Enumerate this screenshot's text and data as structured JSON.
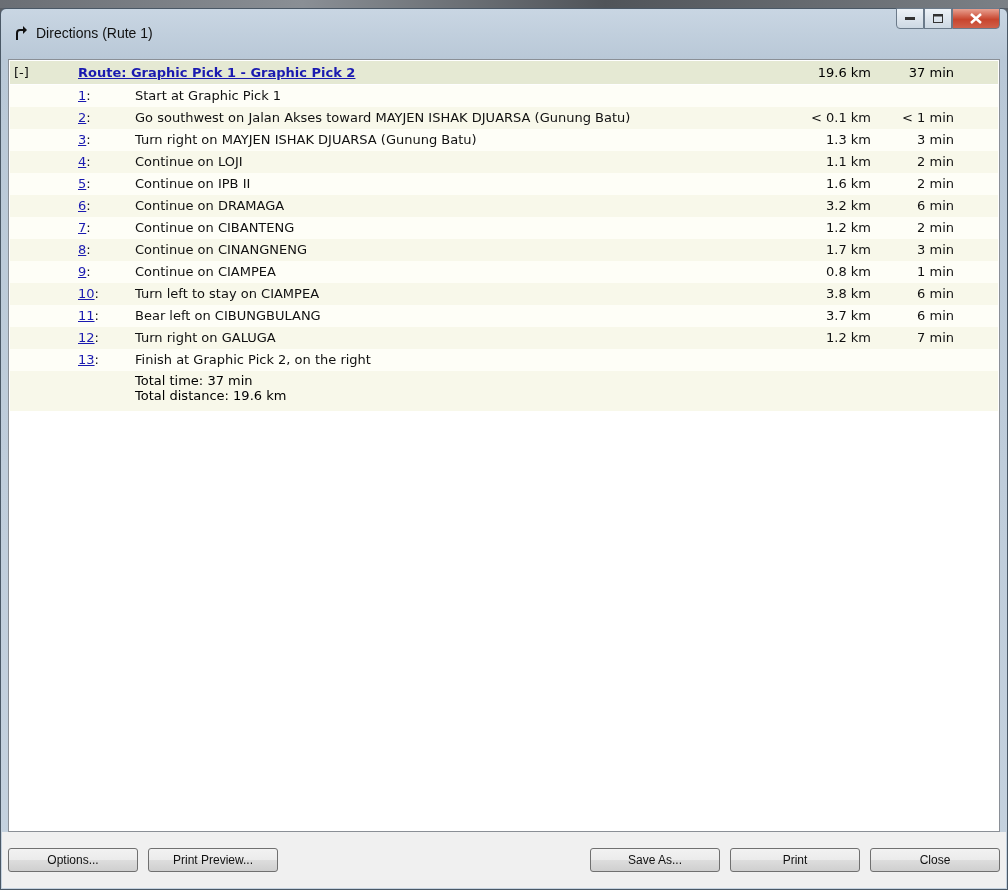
{
  "window": {
    "title": "Directions (Rute 1)"
  },
  "route": {
    "toggle": "[-]",
    "title": "Route: Graphic Pick 1 - Graphic Pick 2",
    "distance": "19.6 km",
    "time": "37 min"
  },
  "step_suffix": ":",
  "steps": [
    {
      "number": "1",
      "text": "Start at Graphic Pick 1"
    },
    {
      "number": "2",
      "text": "Go southwest on Jalan Akses toward MAYJEN ISHAK DJUARSA (Gunung Batu)",
      "distance": "< 0.1 km",
      "time": "< 1 min"
    },
    {
      "number": "3",
      "text": "Turn right on MAYJEN ISHAK DJUARSA (Gunung Batu)",
      "distance": "1.3 km",
      "time": "3 min"
    },
    {
      "number": "4",
      "text": "Continue on LOJI",
      "distance": "1.1 km",
      "time": "2 min"
    },
    {
      "number": "5",
      "text": "Continue on IPB II",
      "distance": "1.6 km",
      "time": "2 min"
    },
    {
      "number": "6",
      "text": "Continue on DRAMAGA",
      "distance": "3.2 km",
      "time": "6 min"
    },
    {
      "number": "7",
      "text": "Continue on CIBANTENG",
      "distance": "1.2 km",
      "time": "2 min"
    },
    {
      "number": "8",
      "text": "Continue on CINANGNENG",
      "distance": "1.7 km",
      "time": "3 min"
    },
    {
      "number": "9",
      "text": "Continue on CIAMPEA",
      "distance": "0.8 km",
      "time": "1 min"
    },
    {
      "number": "10",
      "text": "Turn left to stay on CIAMPEA",
      "distance": "3.8 km",
      "time": "6 min"
    },
    {
      "number": "11",
      "text": "Bear left on CIBUNGBULANG",
      "distance": "3.7 km",
      "time": "6 min"
    },
    {
      "number": "12",
      "text": "Turn right on GALUGA",
      "distance": "1.2 km",
      "time": "7 min"
    },
    {
      "number": "13",
      "text": "Finish at Graphic Pick 2, on the right"
    }
  ],
  "totals": [
    "Total time: 37 min",
    "Total distance: 19.6 km"
  ],
  "buttons_left": [
    "Options...",
    "Print Preview..."
  ],
  "buttons_right": [
    "Save As...",
    "Print",
    "Close"
  ]
}
